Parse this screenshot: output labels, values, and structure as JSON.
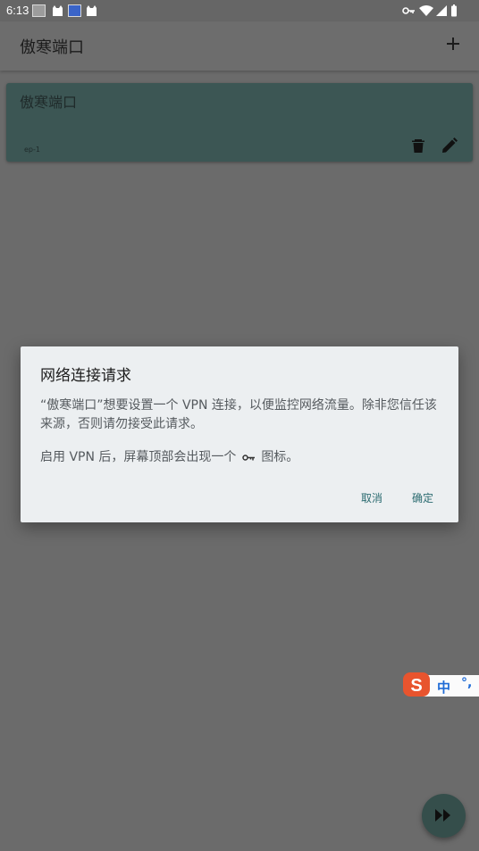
{
  "status_bar": {
    "time": "6:13",
    "notification_icons": [
      "qr-code-icon",
      "cat-app-icon",
      "image-app-icon",
      "cat-app-icon"
    ],
    "right_icons": [
      "vpn-key-icon",
      "wifi-icon",
      "signal-icon",
      "battery-icon"
    ]
  },
  "app_bar": {
    "title": "傲寒端口",
    "add_icon": "plus-icon"
  },
  "profile_card": {
    "title": "傲寒端口",
    "subtitle": "ep-1",
    "delete_icon": "trash-icon",
    "edit_icon": "pencil-icon"
  },
  "dialog": {
    "title": "网络连接请求",
    "message": "“傲寒端口”想要设置一个 VPN 连接，以便监控网络流量。除非您信任该来源，否则请勿接受此请求。",
    "notice_before": "启用 VPN 后，屏幕顶部会出现一个",
    "notice_after": "图标。",
    "notice_icon": "vpn-key-icon",
    "cancel_label": "取消",
    "ok_label": "确定"
  },
  "ime": {
    "logo_letter": "S",
    "mode_label": "中",
    "punct_label": "°,"
  },
  "fab": {
    "icon": "fast-forward-icon"
  },
  "colors": {
    "card_bg": "#3c5654",
    "dialog_bg": "#eceff1",
    "dialog_button": "#2b6b70",
    "fab_bg": "#354e4b",
    "ime_logo": "#e8542e"
  }
}
